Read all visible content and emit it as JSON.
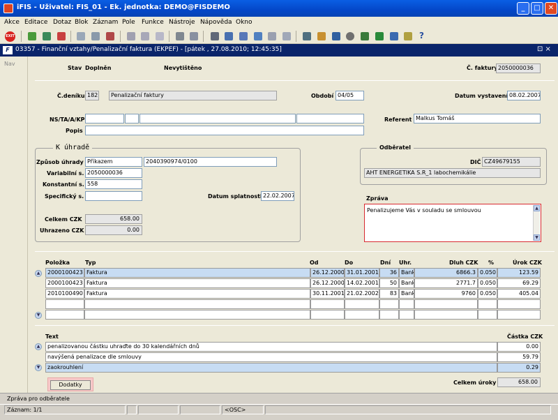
{
  "window": {
    "title": "iFIS - Uživatel: FIS_01 - Ek. jednotka: DEMO@FISDEMO",
    "minimize": "_",
    "maximize": "□",
    "close": "✕"
  },
  "menu": {
    "items": [
      "Akce",
      "Editace",
      "Dotaz",
      "Blok",
      "Záznam",
      "Pole",
      "Funkce",
      "Nástroje",
      "Nápověda",
      "Okno"
    ]
  },
  "toolbar": {
    "exit_label": "EXIT",
    "help_glyph": "?"
  },
  "form_window": {
    "logo": "F",
    "title": "03357 - Finanční vztahy/Penalizační faktura (EKPEF) - [pátek , 27.08.2010; 12:45:35]",
    "controls": "⊡ ×"
  },
  "nav": {
    "label": "Nav"
  },
  "header": {
    "stav_label": "Stav",
    "stav_value": "Doplněn",
    "print_state": "Nevytištěno",
    "cislo_faktury_label": "Č. faktury",
    "cislo_faktury": "2050000036"
  },
  "doc": {
    "cislo_deniku_label": "Č.deníku",
    "cislo_deniku": "182",
    "denik_name": "Penalizační faktury",
    "obdobi_label": "Období",
    "obdobi": "04/05",
    "datum_vystaveni_label": "Datum vystavení",
    "datum_vystaveni": "08.02.2007",
    "ns_label": "NS/TA/A/KP",
    "referent_label": "Referent",
    "referent": "Malkus Tomáš",
    "popis_label": "Popis",
    "popis": ""
  },
  "k_uhrade": {
    "title": "K úhradě",
    "zpusob_label": "Způsob úhrady",
    "zpusob": "Příkazem",
    "ucet": "2040390974/0100",
    "variabilni_label": "Variabilní s.",
    "variabilni": "2050000036",
    "konstantni_label": "Konstantní s.",
    "konstantni": "558",
    "specificky_label": "Specifický s.",
    "specificky": "",
    "datum_splatnosti_label": "Datum splatnosti",
    "datum_splatnosti": "22.02.2007",
    "celkem_label": "Celkem CZK",
    "celkem": "658.00",
    "uhrazeno_label": "Uhrazeno CZK",
    "uhrazeno": "0.00"
  },
  "odberatel": {
    "title": "Odběratel",
    "dic_label": "DIČ",
    "dic": "CZ49679155",
    "name": "AHT ENERGETIKA S.R_1 labochemikálie"
  },
  "zprava": {
    "label": "Zpráva",
    "text": "Penalizujeme Vás v souladu se smlouvou"
  },
  "items_table": {
    "headers": [
      "Položka",
      "Typ",
      "Od",
      "Do",
      "Dní",
      "Uhr.",
      "Dluh CZK",
      "%",
      "Úrok CZK"
    ],
    "rows": [
      [
        "2000100423",
        "Faktura",
        "26.12.2000",
        "31.01.2001",
        "36",
        "Banka",
        "6866.3",
        "0.050",
        "123.59"
      ],
      [
        "2000100423",
        "Faktura",
        "26.12.2000",
        "14.02.2001",
        "50",
        "Banka",
        "2771.7",
        "0.050",
        "69.29"
      ],
      [
        "2010100490",
        "Faktura",
        "30.11.2001",
        "21.02.2002",
        "83",
        "Banka",
        "9760",
        "0.050",
        "405.04"
      ],
      [
        "",
        "",
        "",
        "",
        "",
        "",
        "",
        "",
        ""
      ],
      [
        "",
        "",
        "",
        "",
        "",
        "",
        "",
        "",
        ""
      ]
    ]
  },
  "text_table": {
    "headers": [
      "Text",
      "Částka CZK"
    ],
    "rows": [
      [
        "penalizovanou částku uhraďte do 30 kalendářních dnů",
        "0.00"
      ],
      [
        "navýšená penalizace dle smlouvy",
        "59.79"
      ],
      [
        "zaokrouhlení",
        "0.29"
      ]
    ]
  },
  "footer": {
    "dodatky": "Dodatky",
    "celkem_uroky_label": "Celkem úroky",
    "celkem_uroky": "658.00"
  },
  "status": {
    "message": "Zpráva pro odběratele",
    "record": "Záznam: 1/1",
    "osc": "<OSC>"
  }
}
